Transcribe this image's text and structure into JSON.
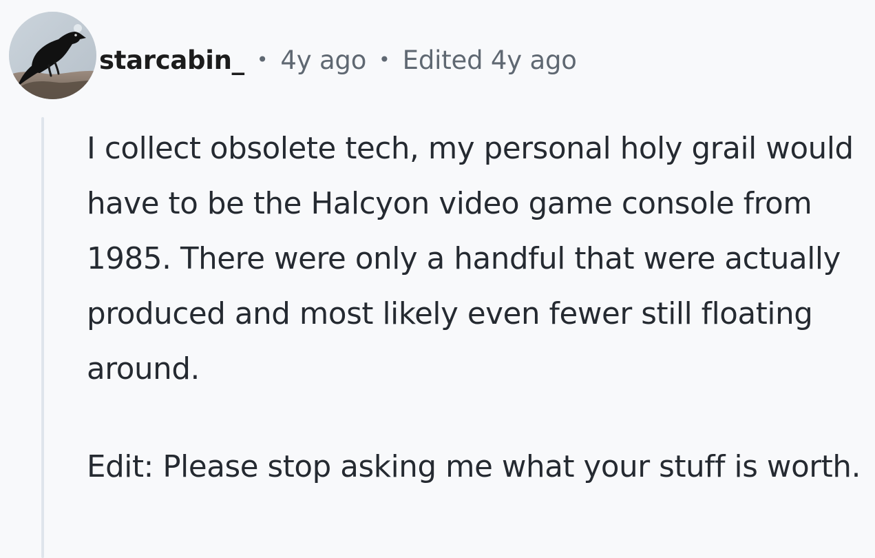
{
  "comment": {
    "avatar": {
      "icon": "crow-avatar-icon"
    },
    "author": "starcabin_",
    "separator": "•",
    "timestamp": "4y ago",
    "edited_label": "Edited 4y ago",
    "paragraphs": [
      "I collect obsolete tech, my personal holy grail would have to be the Halcyon video game console from 1985. There were only a handful that were actually produced and most likely even fewer still floating around.",
      "Edit: Please stop asking me what your stuff is worth."
    ]
  },
  "colors": {
    "background": "#f8f9fb",
    "text_primary": "#252a31",
    "text_secondary": "#5f6872",
    "thread_line": "#dfe5ec"
  }
}
